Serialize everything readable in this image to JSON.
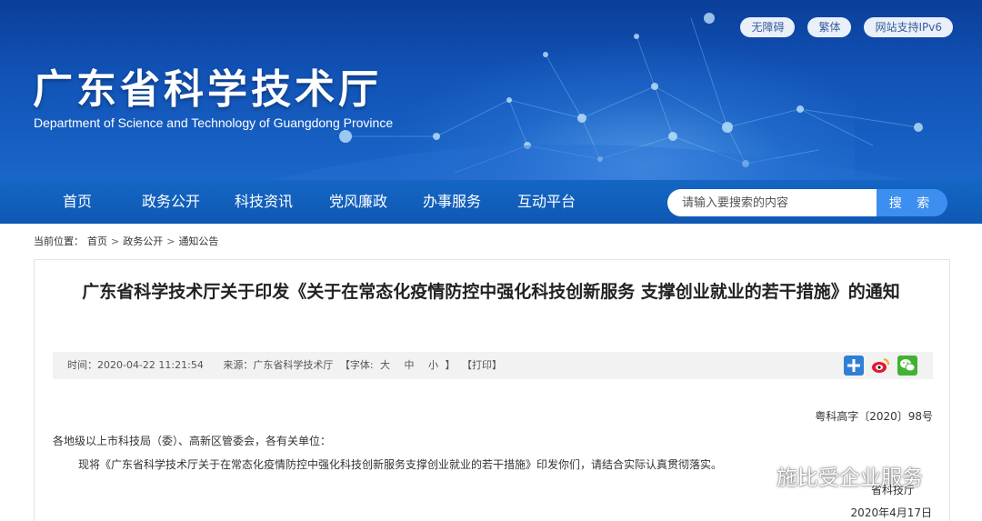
{
  "header": {
    "site_title": "广东省科学技术厅",
    "site_subtitle": "Department of Science and Technology of Guangdong Province",
    "top_links": [
      "无障碍",
      "繁体",
      "网站支持IPv6"
    ]
  },
  "nav": {
    "items": [
      "首页",
      "政务公开",
      "科技资讯",
      "党风廉政",
      "办事服务",
      "互动平台"
    ],
    "search_placeholder": "请输入要搜索的内容",
    "search_button": "搜 索"
  },
  "breadcrumb": {
    "prefix": "当前位置：",
    "items": [
      "首页",
      "政务公开",
      "通知公告"
    ],
    "separator": ">"
  },
  "article": {
    "title": "广东省科学技术厅关于印发《关于在常态化疫情防控中强化科技创新服务 支撑创业就业的若干措施》的通知",
    "meta": {
      "time": "时间：2020-04-22 11:21:54",
      "source": "来源：广东省科学技术厅",
      "font_open": "【字体:",
      "font_large": "大",
      "font_medium": "中",
      "font_small": "小",
      "font_close": "】",
      "print": "【打印】"
    },
    "share_icons": [
      "share-plus-icon",
      "weibo-icon",
      "wechat-icon"
    ],
    "doc_number": "粤科高字〔2020〕98号",
    "addressee": "各地级以上市科技局（委）、高新区管委会，各有关单位：",
    "body": "现将《广东省科学技术厅关于在常态化疫情防控中强化科技创新服务支撑创业就业的若干措施》印发你们，请结合实际认真贯彻落实。",
    "signer": "省科技厅",
    "date": "2020年4月17日"
  },
  "watermark": {
    "text": "施比受企业服务"
  },
  "colors": {
    "banner_dark": "#0a3f9a",
    "nav_blue": "#1466c4",
    "search_button": "#3c8ef0",
    "meta_bg": "#f2f2f2"
  }
}
